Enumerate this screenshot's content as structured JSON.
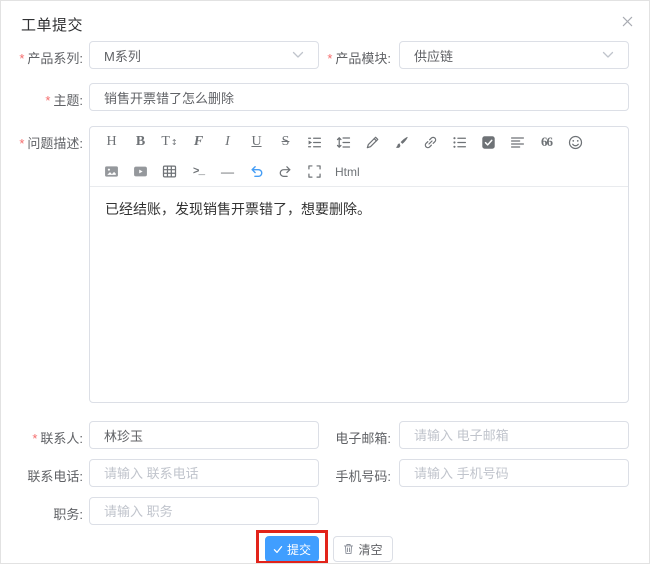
{
  "dialog": {
    "title": "工单提交"
  },
  "form": {
    "required_mark": "*",
    "product_series": {
      "label": "产品系列:",
      "required": true,
      "value": "M系列"
    },
    "product_module": {
      "label": "产品模块:",
      "required": true,
      "value": "供应链"
    },
    "subject": {
      "label": "主题:",
      "required": true,
      "value": "销售开票错了怎么删除"
    },
    "description": {
      "label": "问题描述:",
      "required": true,
      "content": "已经结账，发现销售开票错了，想要删除。"
    },
    "contact": {
      "label": "联系人:",
      "required": true,
      "value": "林珍玉"
    },
    "email": {
      "label": "电子邮箱:",
      "placeholder": "请输入 电子邮箱"
    },
    "phone": {
      "label": "联系电话:",
      "placeholder": "请输入 联系电话"
    },
    "mobile": {
      "label": "手机号码:",
      "placeholder": "请输入 手机号码"
    },
    "position": {
      "label": "职务:",
      "placeholder": "请输入 职务"
    }
  },
  "editor": {
    "toolbar_row1": [
      "heading",
      "bold",
      "font-size",
      "font-family",
      "italic",
      "underline",
      "strikethrough",
      "indent",
      "line-height",
      "pen",
      "brush",
      "link",
      "unordered-list",
      "task-list",
      "align",
      "quote",
      "emoji"
    ],
    "toolbar_row2": [
      "image",
      "video",
      "table",
      "code",
      "hr",
      "undo",
      "redo",
      "fullscreen",
      "html"
    ]
  },
  "buttons": {
    "submit": "提交",
    "clear": "清空"
  },
  "colors": {
    "primary": "#409EFF",
    "annotation_red": "#E2231A",
    "required_red": "#F56C6C",
    "border": "#DCDFE6",
    "placeholder": "#C0C4CC",
    "label_text": "#606266",
    "toolbar_icon": "#6E7276",
    "undo_blue": "#459DF5"
  }
}
